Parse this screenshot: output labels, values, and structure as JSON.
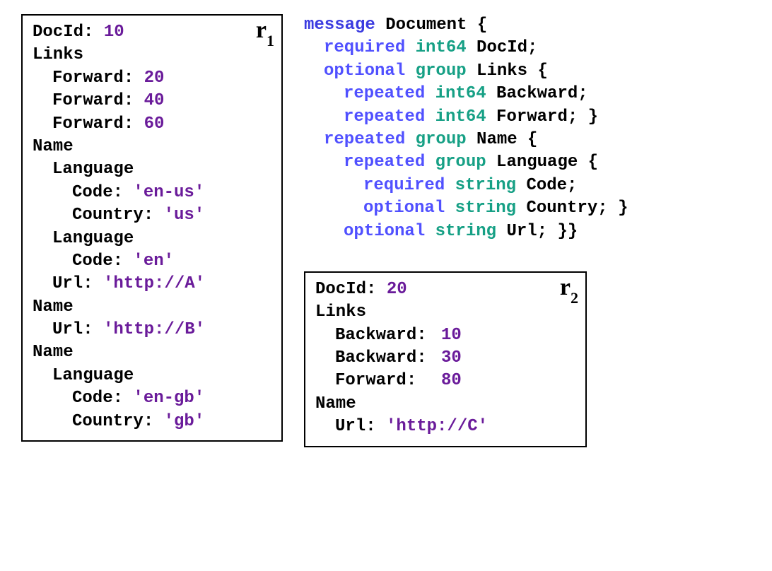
{
  "r1": {
    "label_base": "r",
    "label_sub": "1",
    "lines": [
      {
        "indent": 0,
        "parts": [
          {
            "cls": "fld",
            "t": "DocId: "
          },
          {
            "cls": "val",
            "t": "10"
          }
        ]
      },
      {
        "indent": 0,
        "parts": [
          {
            "cls": "fld",
            "t": "Links"
          }
        ]
      },
      {
        "indent": 1,
        "parts": [
          {
            "cls": "fld",
            "t": "Forward: "
          },
          {
            "cls": "val",
            "t": "20"
          }
        ]
      },
      {
        "indent": 1,
        "parts": [
          {
            "cls": "fld",
            "t": "Forward: "
          },
          {
            "cls": "val",
            "t": "40"
          }
        ]
      },
      {
        "indent": 1,
        "parts": [
          {
            "cls": "fld",
            "t": "Forward: "
          },
          {
            "cls": "val",
            "t": "60"
          }
        ]
      },
      {
        "indent": 0,
        "parts": [
          {
            "cls": "fld",
            "t": "Name"
          }
        ]
      },
      {
        "indent": 1,
        "parts": [
          {
            "cls": "fld",
            "t": "Language"
          }
        ]
      },
      {
        "indent": 2,
        "parts": [
          {
            "cls": "fld",
            "t": "Code: "
          },
          {
            "cls": "val",
            "t": "'en-us'"
          }
        ]
      },
      {
        "indent": 2,
        "parts": [
          {
            "cls": "fld",
            "t": "Country: "
          },
          {
            "cls": "val",
            "t": "'us'"
          }
        ]
      },
      {
        "indent": 1,
        "parts": [
          {
            "cls": "fld",
            "t": "Language"
          }
        ]
      },
      {
        "indent": 2,
        "parts": [
          {
            "cls": "fld",
            "t": "Code: "
          },
          {
            "cls": "val",
            "t": "'en'"
          }
        ]
      },
      {
        "indent": 1,
        "parts": [
          {
            "cls": "fld",
            "t": "Url: "
          },
          {
            "cls": "val",
            "t": "'http://A'"
          }
        ]
      },
      {
        "indent": 0,
        "parts": [
          {
            "cls": "fld",
            "t": "Name"
          }
        ]
      },
      {
        "indent": 1,
        "parts": [
          {
            "cls": "fld",
            "t": "Url: "
          },
          {
            "cls": "val",
            "t": "'http://B'"
          }
        ]
      },
      {
        "indent": 0,
        "parts": [
          {
            "cls": "fld",
            "t": "Name"
          }
        ]
      },
      {
        "indent": 1,
        "parts": [
          {
            "cls": "fld",
            "t": "Language"
          }
        ]
      },
      {
        "indent": 2,
        "parts": [
          {
            "cls": "fld",
            "t": "Code: "
          },
          {
            "cls": "val",
            "t": "'en-gb'"
          }
        ]
      },
      {
        "indent": 2,
        "parts": [
          {
            "cls": "fld",
            "t": "Country: "
          },
          {
            "cls": "val",
            "t": "'gb'"
          }
        ]
      }
    ]
  },
  "r2": {
    "label_base": "r",
    "label_sub": "2",
    "lines": [
      {
        "indent": 0,
        "parts": [
          {
            "cls": "fld",
            "t": "DocId: "
          },
          {
            "cls": "val",
            "t": "20"
          }
        ]
      },
      {
        "indent": 0,
        "parts": [
          {
            "cls": "fld",
            "t": "Links"
          }
        ]
      },
      {
        "indent": 1,
        "parts": [
          {
            "cls": "fld padline",
            "t": "Backward: "
          },
          {
            "cls": "val",
            "t": "10"
          }
        ]
      },
      {
        "indent": 1,
        "parts": [
          {
            "cls": "fld padline",
            "t": "Backward: "
          },
          {
            "cls": "val",
            "t": "30"
          }
        ]
      },
      {
        "indent": 1,
        "parts": [
          {
            "cls": "fld padline",
            "t": "Forward:  "
          },
          {
            "cls": "val",
            "t": "80"
          }
        ]
      },
      {
        "indent": 0,
        "parts": [
          {
            "cls": "fld",
            "t": "Name"
          }
        ]
      },
      {
        "indent": 1,
        "parts": [
          {
            "cls": "fld",
            "t": "Url: "
          },
          {
            "cls": "val",
            "t": "'http://C'"
          }
        ]
      }
    ]
  },
  "schema": {
    "lines": [
      {
        "indent": 0,
        "parts": [
          {
            "cls": "kw1",
            "t": "message"
          },
          {
            "cls": "fld",
            "t": " Document {"
          }
        ]
      },
      {
        "indent": 1,
        "parts": [
          {
            "cls": "kw2",
            "t": "required"
          },
          {
            "cls": "fld",
            "t": " "
          },
          {
            "cls": "ty",
            "t": "int64"
          },
          {
            "cls": "fld",
            "t": " DocId;"
          }
        ]
      },
      {
        "indent": 1,
        "parts": [
          {
            "cls": "kw2",
            "t": "optional"
          },
          {
            "cls": "fld",
            "t": " "
          },
          {
            "cls": "grp",
            "t": "group"
          },
          {
            "cls": "fld",
            "t": " Links {"
          }
        ]
      },
      {
        "indent": 2,
        "parts": [
          {
            "cls": "kw2",
            "t": "repeated"
          },
          {
            "cls": "fld",
            "t": " "
          },
          {
            "cls": "ty",
            "t": "int64"
          },
          {
            "cls": "fld",
            "t": " Backward;"
          }
        ]
      },
      {
        "indent": 2,
        "parts": [
          {
            "cls": "kw2",
            "t": "repeated"
          },
          {
            "cls": "fld",
            "t": " "
          },
          {
            "cls": "ty",
            "t": "int64"
          },
          {
            "cls": "fld",
            "t": " Forward; }"
          }
        ]
      },
      {
        "indent": 1,
        "parts": [
          {
            "cls": "kw2",
            "t": "repeated"
          },
          {
            "cls": "fld",
            "t": " "
          },
          {
            "cls": "grp",
            "t": "group"
          },
          {
            "cls": "fld",
            "t": " Name {"
          }
        ]
      },
      {
        "indent": 2,
        "parts": [
          {
            "cls": "kw2",
            "t": "repeated"
          },
          {
            "cls": "fld",
            "t": " "
          },
          {
            "cls": "grp",
            "t": "group"
          },
          {
            "cls": "fld",
            "t": " Language {"
          }
        ]
      },
      {
        "indent": 3,
        "parts": [
          {
            "cls": "kw2",
            "t": "required"
          },
          {
            "cls": "fld",
            "t": " "
          },
          {
            "cls": "ty",
            "t": "string"
          },
          {
            "cls": "fld",
            "t": " Code;"
          }
        ]
      },
      {
        "indent": 3,
        "parts": [
          {
            "cls": "kw2",
            "t": "optional"
          },
          {
            "cls": "fld",
            "t": " "
          },
          {
            "cls": "ty",
            "t": "string"
          },
          {
            "cls": "fld",
            "t": " Country; }"
          }
        ]
      },
      {
        "indent": 2,
        "parts": [
          {
            "cls": "kw2",
            "t": "optional"
          },
          {
            "cls": "fld",
            "t": " "
          },
          {
            "cls": "ty",
            "t": "string"
          },
          {
            "cls": "fld",
            "t": " Url; }}"
          }
        ]
      }
    ]
  }
}
